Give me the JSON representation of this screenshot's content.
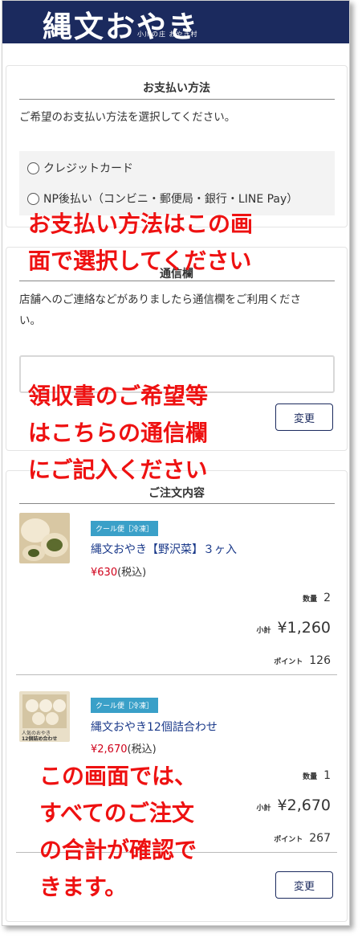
{
  "header": {
    "logo": "縄文おやき",
    "logo_sub": "小川の庄 おやき村"
  },
  "payment": {
    "title": "お支払い方法",
    "desc": "ご希望のお支払い方法を選択してください。",
    "options": [
      "クレジットカード",
      "NP後払い（コンビニ・郵便局・銀行・LINE Pay）"
    ]
  },
  "message": {
    "title": "通信欄",
    "desc1": "店舗へのご連絡などがありましたら通信欄をご利用くださ",
    "desc2": "い。",
    "change_label": "変更"
  },
  "order": {
    "title": "ご注文内容",
    "items": [
      {
        "badge": "クール便［冷凍］",
        "name": "縄文おやき【野沢菜】３ヶ入",
        "price": "¥630",
        "tax": "(税込)",
        "qty_label": "数量",
        "qty": "2",
        "subtotal_label": "小計",
        "subtotal": "¥1,260",
        "point_label": "ポイント",
        "point": "126"
      },
      {
        "badge": "クール便［冷凍］",
        "name": "縄文おやき12個詰合わせ",
        "price": "¥2,670",
        "tax": "(税込)",
        "qty_label": "数量",
        "qty": "1",
        "subtotal_label": "小計",
        "subtotal": "¥2,670",
        "point_label": "ポイント",
        "point": "267"
      }
    ],
    "thumb2_text1": "人気のおやき",
    "thumb2_text2": "12個詰め合わせ",
    "change_label": "変更"
  },
  "annotations": {
    "a1_line1": "お支払い方法はこの画",
    "a1_line2": "面で選択してください",
    "a2_line1": "領収書のご希望等",
    "a2_line2": "はこちらの通信欄",
    "a2_line3": "にご記入ください",
    "a3_line1": "この画面では、",
    "a3_line2": "すべてのご注文",
    "a3_line3": "の合計が確認で",
    "a3_line4": "きます。"
  }
}
